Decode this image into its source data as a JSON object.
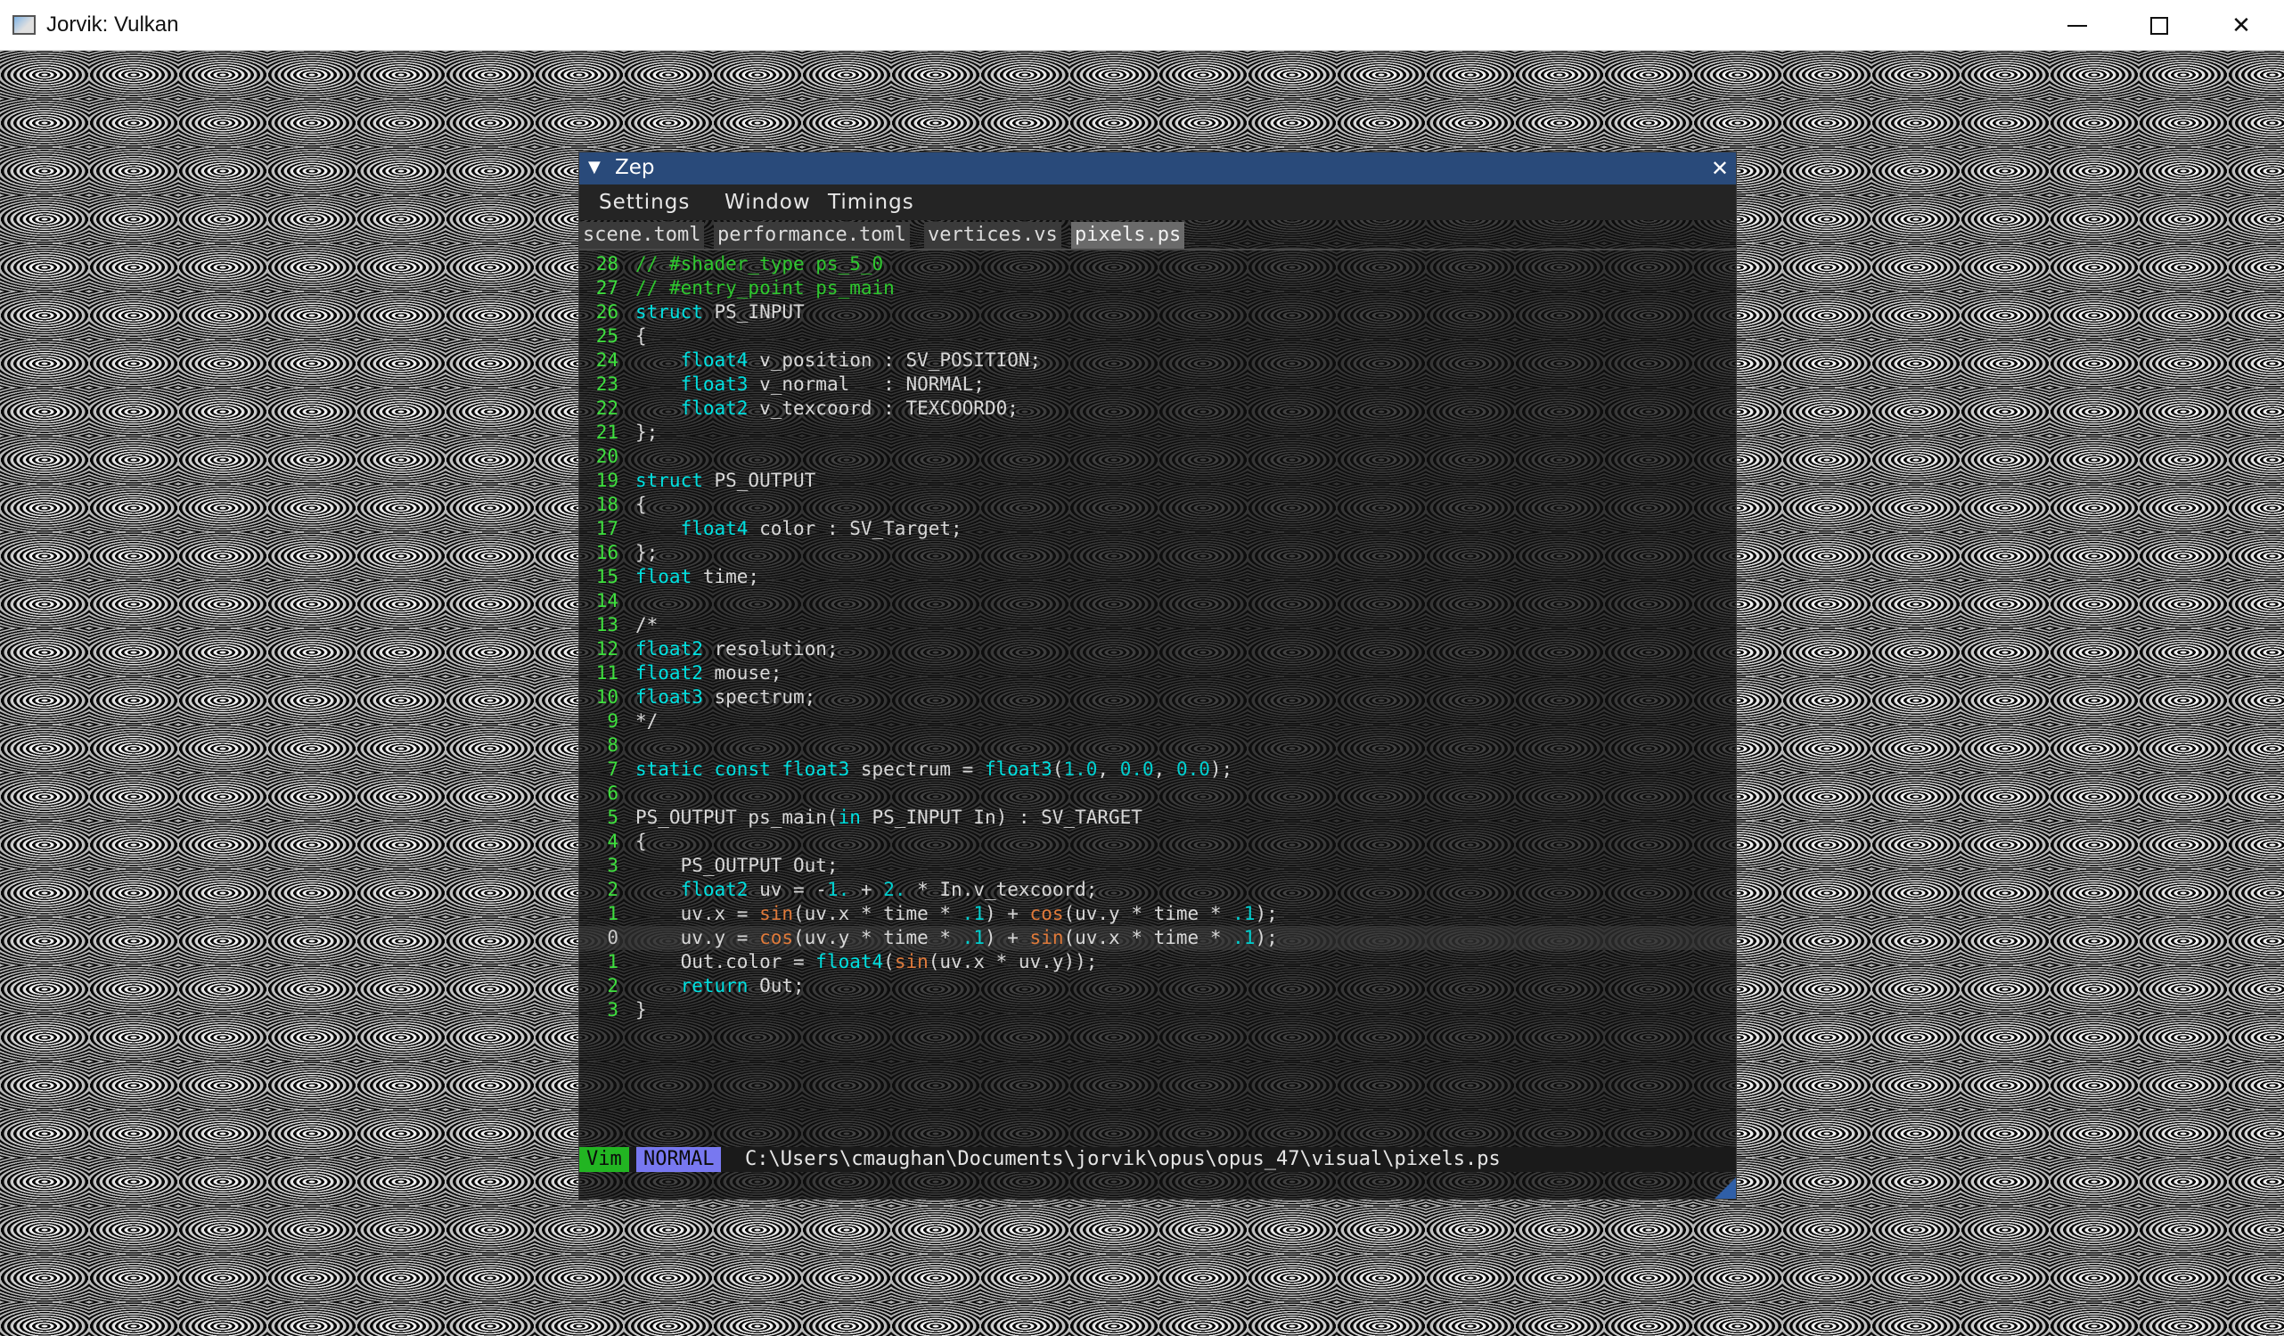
{
  "window": {
    "title": "Jorvik: Vulkan",
    "controls": {
      "minimize": "—",
      "maximize": "☐",
      "close": "✕"
    }
  },
  "zep": {
    "title": "Zep",
    "collapse_glyph": "▼",
    "close_glyph": "✕",
    "menu": [
      "Settings",
      "Window",
      "Timings"
    ],
    "tabs": [
      "scene.toml",
      "performance.toml",
      "vertices.vs",
      "pixels.ps"
    ],
    "active_tab": "pixels.ps",
    "status": {
      "editor_mode": "Vim",
      "vim_mode": "NORMAL",
      "file_path": "C:\\Users\\cmaughan\\Documents\\jorvik\\opus\\opus_47\\visual\\pixels.ps"
    },
    "colors": {
      "titlebar": "#294a7a",
      "line_numbers": "#3ee03e",
      "keyword": "#00e0e0",
      "comment": "#2ec82e",
      "function": "#e07a3a",
      "vim_badge": "#22b522",
      "normal_badge": "#7878f0"
    },
    "line_numbers": [
      "28",
      "27",
      "26",
      "25",
      "24",
      "23",
      "22",
      "21",
      "20",
      "19",
      "18",
      "17",
      "16",
      "15",
      "14",
      "13",
      "12",
      "11",
      "10",
      "9",
      "8",
      "7",
      "6",
      "5",
      "4",
      "3",
      "2",
      "1",
      "0",
      "1",
      "2",
      "3"
    ],
    "current_line_index": 28,
    "code": [
      "// #shader_type ps_5_0",
      "// #entry_point ps_main",
      "struct PS_INPUT",
      "{",
      "    float4 v_position : SV_POSITION;",
      "    float3 v_normal   : NORMAL;",
      "    float2 v_texcoord : TEXCOORD0;",
      "};",
      "",
      "struct PS_OUTPUT",
      "{",
      "    float4 color : SV_Target;",
      "};",
      "float time;",
      "",
      "/*",
      "float2 resolution;",
      "float2 mouse;",
      "float3 spectrum;",
      "*/",
      "",
      "static const float3 spectrum = float3(1.0, 0.0, 0.0);",
      "",
      "PS_OUTPUT ps_main(in PS_INPUT In) : SV_TARGET",
      "{",
      "    PS_OUTPUT Out;",
      "    float2 uv = -1. + 2. * In.v_texcoord;",
      "    uv.x = sin(uv.x * time * .1) + cos(uv.y * time * .1);",
      "    uv.y = cos(uv.y * time * .1) + sin(uv.x * time * .1);",
      "    Out.color = float4(sin(uv.x * uv.y));",
      "    return Out;",
      "}"
    ]
  }
}
